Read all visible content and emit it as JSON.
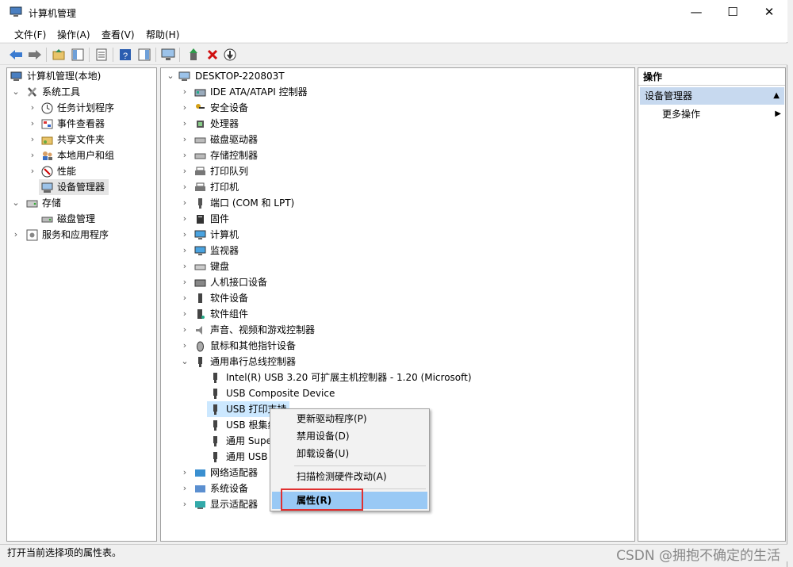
{
  "window": {
    "title": "计算机管理",
    "minimize": "—",
    "maximize": "☐",
    "close": "✕"
  },
  "menu": [
    "文件(F)",
    "操作(A)",
    "查看(V)",
    "帮助(H)"
  ],
  "left_tree": {
    "root": "计算机管理(本地)",
    "system_tools": "系统工具",
    "items": [
      "任务计划程序",
      "事件查看器",
      "共享文件夹",
      "本地用户和组",
      "性能",
      "设备管理器"
    ],
    "storage": "存储",
    "disk_mgmt": "磁盘管理",
    "services": "服务和应用程序"
  },
  "device_tree": {
    "root": "DESKTOP-220803T",
    "categories": [
      "IDE ATA/ATAPI 控制器",
      "安全设备",
      "处理器",
      "磁盘驱动器",
      "存储控制器",
      "打印队列",
      "打印机",
      "端口 (COM 和 LPT)",
      "固件",
      "计算机",
      "监视器",
      "键盘",
      "人机接口设备",
      "软件设备",
      "软件组件",
      "声音、视频和游戏控制器",
      "鼠标和其他指针设备"
    ],
    "usb_category": "通用串行总线控制器",
    "usb_children": [
      "Intel(R) USB 3.20 可扩展主机控制器 - 1.20 (Microsoft)",
      "USB Composite Device",
      "USB 打印支持",
      "USB 根集线器",
      "通用 Supe",
      "通用 USB"
    ],
    "after_categories": [
      "网络适配器",
      "系统设备",
      "显示适配器"
    ]
  },
  "actions": {
    "header": "操作",
    "section": "设备管理器",
    "more": "更多操作"
  },
  "context_menu": {
    "items": [
      "更新驱动程序(P)",
      "禁用设备(D)",
      "卸载设备(U)"
    ],
    "scan": "扫描检测硬件改动(A)",
    "properties": "属性(R)",
    "highlight_color": "#e03030"
  },
  "status": "打开当前选择项的属性表。",
  "watermark": "CSDN @拥抱不确定的生活"
}
